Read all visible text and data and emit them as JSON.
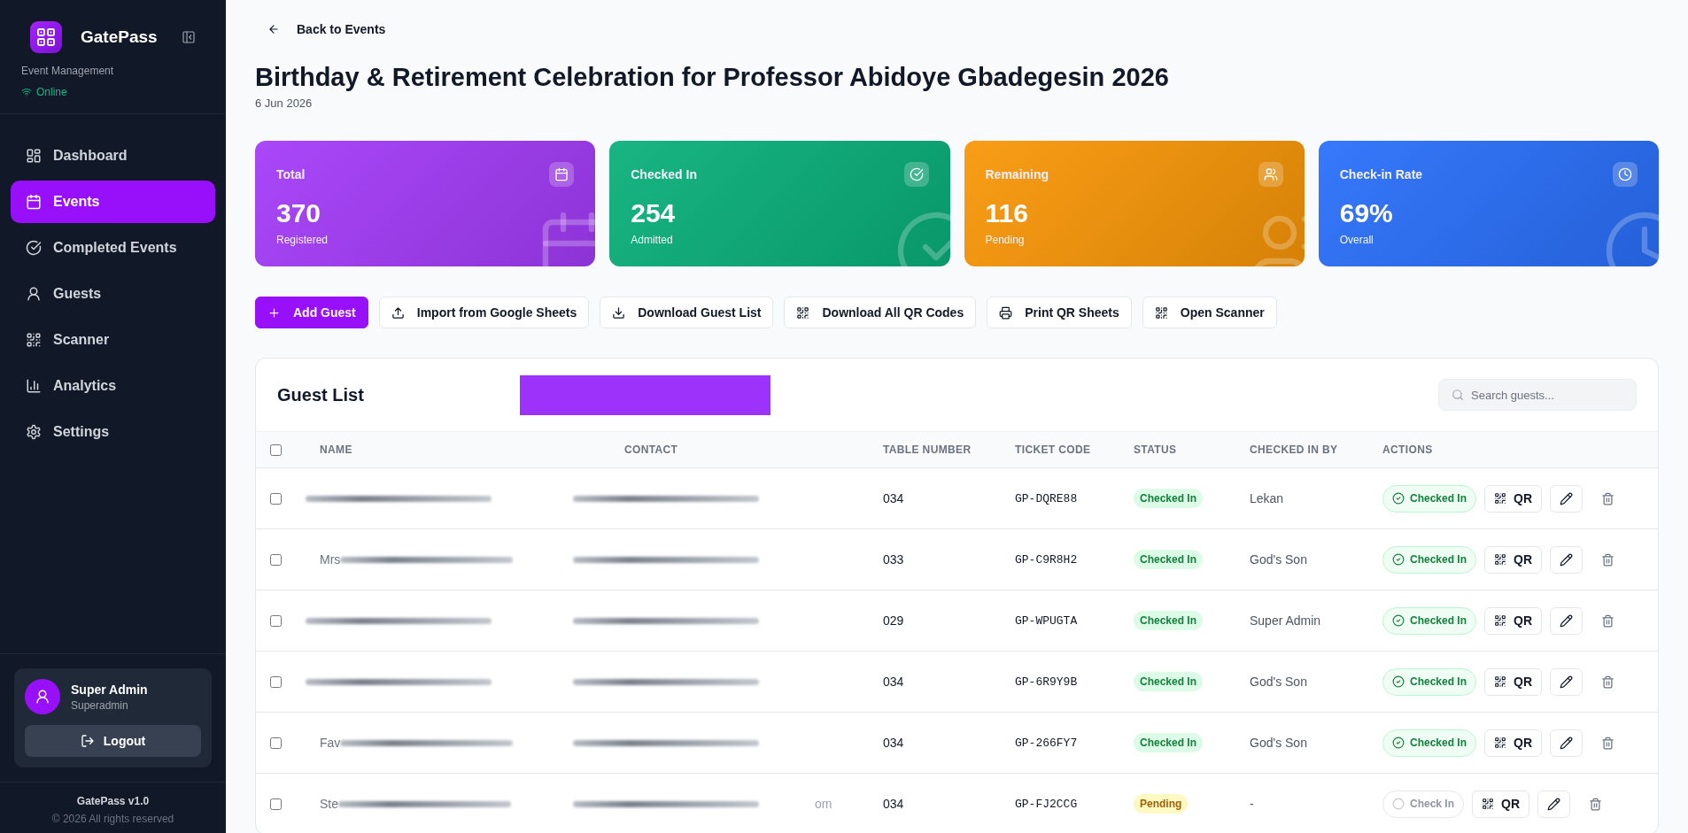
{
  "sidebar": {
    "brand": "GatePass",
    "subtitle": "Event Management",
    "connection": "Online",
    "nav": [
      {
        "label": "Dashboard",
        "selected": false
      },
      {
        "label": "Events",
        "selected": true
      },
      {
        "label": "Completed Events",
        "selected": false
      },
      {
        "label": "Guests",
        "selected": false
      },
      {
        "label": "Scanner",
        "selected": false
      },
      {
        "label": "Analytics",
        "selected": false
      },
      {
        "label": "Settings",
        "selected": false
      }
    ],
    "user": {
      "name": "Super Admin",
      "role": "Superadmin"
    },
    "logout_label": "Logout",
    "footer": {
      "version": "GatePass v1.0",
      "copyright": "© 2026 All rights reserved"
    }
  },
  "page": {
    "back_link": "Back to Events",
    "title": "Birthday & Retirement Celebration for Professor Abidoye Gbadegesin 2026",
    "date": "6 Jun 2026"
  },
  "stats": [
    {
      "label": "Total",
      "value": "370",
      "caption": "Registered",
      "color": "#a43cf9"
    },
    {
      "label": "Checked In",
      "value": "254",
      "caption": "Admitted",
      "color": "#0ab07a"
    },
    {
      "label": "Remaining",
      "value": "116",
      "caption": "Pending",
      "color": "#f99708"
    },
    {
      "label": "Check-in Rate",
      "value": "69%",
      "caption": "Overall",
      "color": "#2a70fb"
    }
  ],
  "toolbar": [
    {
      "label": "Add Guest",
      "kind": "primary"
    },
    {
      "label": "Import from Google Sheets",
      "kind": "secondary"
    },
    {
      "label": "Download Guest List",
      "kind": "secondary"
    },
    {
      "label": "Download All QR Codes",
      "kind": "secondary"
    },
    {
      "label": "Print QR Sheets",
      "kind": "secondary"
    },
    {
      "label": "Open Scanner",
      "kind": "secondary"
    }
  ],
  "guest_list": {
    "title": "Guest List",
    "search": {
      "placeholder": "Search guests..."
    },
    "select_all": {
      "checked": false
    },
    "columns": [
      "NAME",
      "CONTACT",
      "TABLE NUMBER",
      "TICKET CODE",
      "STATUS",
      "CHECKED IN BY",
      "ACTIONS"
    ],
    "rows": [
      {
        "checked": false,
        "table_number": "034",
        "ticket_code": "GP-DQRE88",
        "status": {
          "kind": "checked_in",
          "label": "Checked In"
        },
        "checked_in_by": "Lekan",
        "check_action": {
          "kind": "checked_in",
          "label": "Checked In"
        },
        "qr_label": "QR"
      },
      {
        "checked": false,
        "name_prefix": "Mrs",
        "table_number": "033",
        "ticket_code": "GP-C9R8H2",
        "status": {
          "kind": "checked_in",
          "label": "Checked In"
        },
        "checked_in_by": "God's Son",
        "check_action": {
          "kind": "checked_in",
          "label": "Checked In"
        },
        "qr_label": "QR"
      },
      {
        "checked": false,
        "table_number": "029",
        "ticket_code": "GP-WPUGTA",
        "status": {
          "kind": "checked_in",
          "label": "Checked In"
        },
        "checked_in_by": "Super Admin",
        "check_action": {
          "kind": "checked_in",
          "label": "Checked In"
        },
        "qr_label": "QR"
      },
      {
        "checked": false,
        "table_number": "034",
        "ticket_code": "GP-6R9Y9B",
        "status": {
          "kind": "checked_in",
          "label": "Checked In"
        },
        "checked_in_by": "God's Son",
        "check_action": {
          "kind": "checked_in",
          "label": "Checked In"
        },
        "qr_label": "QR"
      },
      {
        "checked": false,
        "name_prefix": "Fav",
        "table_number": "034",
        "ticket_code": "GP-266FY7",
        "status": {
          "kind": "checked_in",
          "label": "Checked In"
        },
        "checked_in_by": "God's Son",
        "check_action": {
          "kind": "checked_in",
          "label": "Checked In"
        },
        "qr_label": "QR"
      },
      {
        "checked": false,
        "name_prefix": "Ste",
        "contact_suffix": "om",
        "table_number": "034",
        "ticket_code": "GP-FJ2CCG",
        "status": {
          "kind": "pending",
          "label": "Pending"
        },
        "checked_in_by": "-",
        "check_action": {
          "kind": "check_in",
          "label": "Check In"
        },
        "qr_label": "QR"
      }
    ]
  }
}
